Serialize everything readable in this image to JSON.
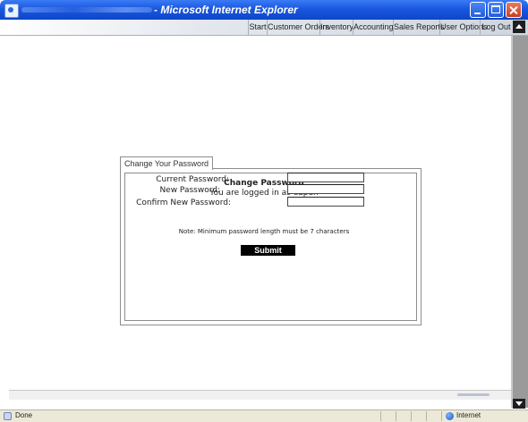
{
  "window": {
    "title": "- Microsoft Internet Explorer"
  },
  "nav": {
    "items": [
      {
        "label": "Start"
      },
      {
        "label": "Customer Orders"
      },
      {
        "label": "Inventory"
      },
      {
        "label": "Accounting"
      },
      {
        "label": "Sales Reports"
      },
      {
        "label": "User Options"
      },
      {
        "label": "Log Out"
      }
    ]
  },
  "form": {
    "tab_label": "Change Your Password",
    "heading": "Change Password",
    "subheading": "You are logged in as eapen",
    "fields": [
      {
        "label": "Current Password:",
        "value": ""
      },
      {
        "label": "New Password:",
        "value": ""
      },
      {
        "label": "Confirm New Password:",
        "value": ""
      }
    ],
    "note": "Note: Minimum password length must be 7 characters",
    "submit_label": "Submit"
  },
  "status": {
    "left_text": "Done",
    "zone_text": "Internet"
  },
  "colors": {
    "titlebar": "#0e46c9",
    "submit_bg": "#000000"
  },
  "icons": [
    "ie-app-icon",
    "minimize-icon",
    "maximize-icon",
    "close-icon",
    "scroll-up-icon",
    "scroll-down-icon",
    "page-done-icon",
    "internet-globe-icon"
  ]
}
